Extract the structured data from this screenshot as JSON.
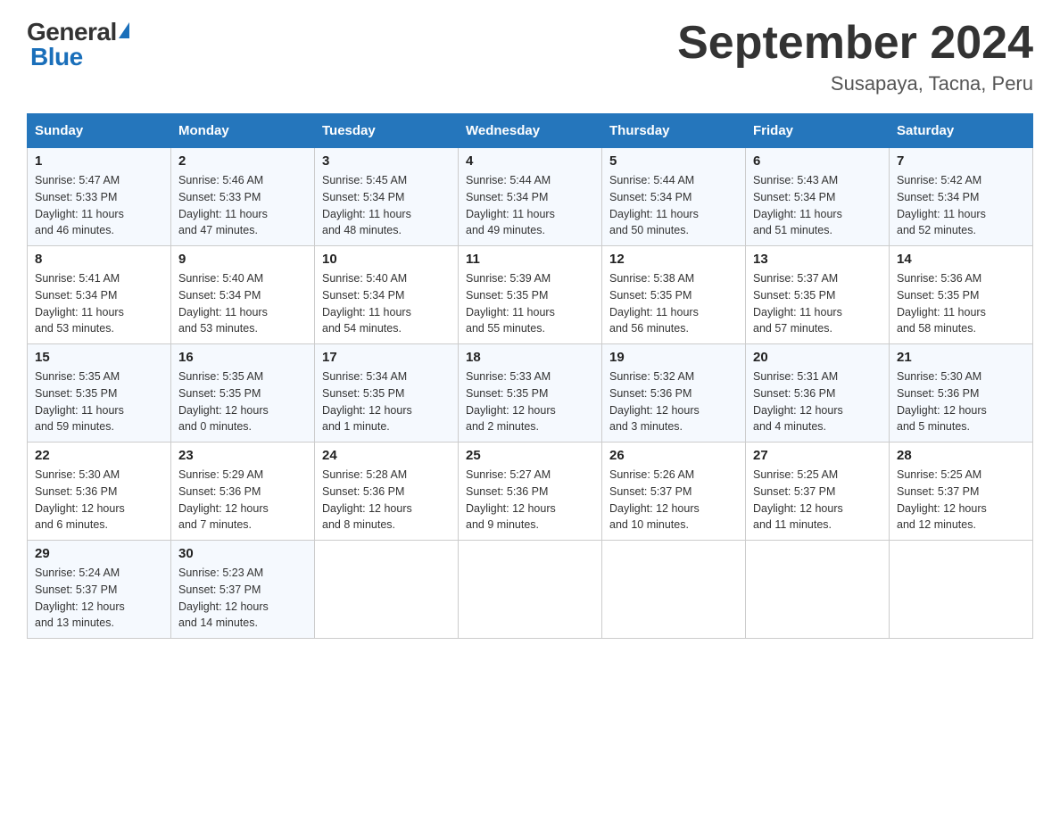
{
  "logo": {
    "general": "General",
    "blue": "Blue"
  },
  "title": "September 2024",
  "location": "Susapaya, Tacna, Peru",
  "weekdays": [
    "Sunday",
    "Monday",
    "Tuesday",
    "Wednesday",
    "Thursday",
    "Friday",
    "Saturday"
  ],
  "weeks": [
    [
      {
        "day": "1",
        "sunrise": "5:47 AM",
        "sunset": "5:33 PM",
        "daylight": "11 hours and 46 minutes."
      },
      {
        "day": "2",
        "sunrise": "5:46 AM",
        "sunset": "5:33 PM",
        "daylight": "11 hours and 47 minutes."
      },
      {
        "day": "3",
        "sunrise": "5:45 AM",
        "sunset": "5:34 PM",
        "daylight": "11 hours and 48 minutes."
      },
      {
        "day": "4",
        "sunrise": "5:44 AM",
        "sunset": "5:34 PM",
        "daylight": "11 hours and 49 minutes."
      },
      {
        "day": "5",
        "sunrise": "5:44 AM",
        "sunset": "5:34 PM",
        "daylight": "11 hours and 50 minutes."
      },
      {
        "day": "6",
        "sunrise": "5:43 AM",
        "sunset": "5:34 PM",
        "daylight": "11 hours and 51 minutes."
      },
      {
        "day": "7",
        "sunrise": "5:42 AM",
        "sunset": "5:34 PM",
        "daylight": "11 hours and 52 minutes."
      }
    ],
    [
      {
        "day": "8",
        "sunrise": "5:41 AM",
        "sunset": "5:34 PM",
        "daylight": "11 hours and 53 minutes."
      },
      {
        "day": "9",
        "sunrise": "5:40 AM",
        "sunset": "5:34 PM",
        "daylight": "11 hours and 53 minutes."
      },
      {
        "day": "10",
        "sunrise": "5:40 AM",
        "sunset": "5:34 PM",
        "daylight": "11 hours and 54 minutes."
      },
      {
        "day": "11",
        "sunrise": "5:39 AM",
        "sunset": "5:35 PM",
        "daylight": "11 hours and 55 minutes."
      },
      {
        "day": "12",
        "sunrise": "5:38 AM",
        "sunset": "5:35 PM",
        "daylight": "11 hours and 56 minutes."
      },
      {
        "day": "13",
        "sunrise": "5:37 AM",
        "sunset": "5:35 PM",
        "daylight": "11 hours and 57 minutes."
      },
      {
        "day": "14",
        "sunrise": "5:36 AM",
        "sunset": "5:35 PM",
        "daylight": "11 hours and 58 minutes."
      }
    ],
    [
      {
        "day": "15",
        "sunrise": "5:35 AM",
        "sunset": "5:35 PM",
        "daylight": "11 hours and 59 minutes."
      },
      {
        "day": "16",
        "sunrise": "5:35 AM",
        "sunset": "5:35 PM",
        "daylight": "12 hours and 0 minutes."
      },
      {
        "day": "17",
        "sunrise": "5:34 AM",
        "sunset": "5:35 PM",
        "daylight": "12 hours and 1 minute."
      },
      {
        "day": "18",
        "sunrise": "5:33 AM",
        "sunset": "5:35 PM",
        "daylight": "12 hours and 2 minutes."
      },
      {
        "day": "19",
        "sunrise": "5:32 AM",
        "sunset": "5:36 PM",
        "daylight": "12 hours and 3 minutes."
      },
      {
        "day": "20",
        "sunrise": "5:31 AM",
        "sunset": "5:36 PM",
        "daylight": "12 hours and 4 minutes."
      },
      {
        "day": "21",
        "sunrise": "5:30 AM",
        "sunset": "5:36 PM",
        "daylight": "12 hours and 5 minutes."
      }
    ],
    [
      {
        "day": "22",
        "sunrise": "5:30 AM",
        "sunset": "5:36 PM",
        "daylight": "12 hours and 6 minutes."
      },
      {
        "day": "23",
        "sunrise": "5:29 AM",
        "sunset": "5:36 PM",
        "daylight": "12 hours and 7 minutes."
      },
      {
        "day": "24",
        "sunrise": "5:28 AM",
        "sunset": "5:36 PM",
        "daylight": "12 hours and 8 minutes."
      },
      {
        "day": "25",
        "sunrise": "5:27 AM",
        "sunset": "5:36 PM",
        "daylight": "12 hours and 9 minutes."
      },
      {
        "day": "26",
        "sunrise": "5:26 AM",
        "sunset": "5:37 PM",
        "daylight": "12 hours and 10 minutes."
      },
      {
        "day": "27",
        "sunrise": "5:25 AM",
        "sunset": "5:37 PM",
        "daylight": "12 hours and 11 minutes."
      },
      {
        "day": "28",
        "sunrise": "5:25 AM",
        "sunset": "5:37 PM",
        "daylight": "12 hours and 12 minutes."
      }
    ],
    [
      {
        "day": "29",
        "sunrise": "5:24 AM",
        "sunset": "5:37 PM",
        "daylight": "12 hours and 13 minutes."
      },
      {
        "day": "30",
        "sunrise": "5:23 AM",
        "sunset": "5:37 PM",
        "daylight": "12 hours and 14 minutes."
      },
      null,
      null,
      null,
      null,
      null
    ]
  ],
  "labels": {
    "sunrise": "Sunrise:",
    "sunset": "Sunset:",
    "daylight": "Daylight:"
  }
}
